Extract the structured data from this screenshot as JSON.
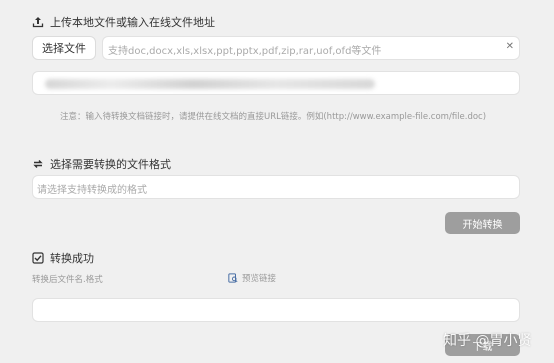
{
  "upload": {
    "title": "上传本地文件或输入在线文件地址",
    "select_button": "选择文件",
    "file_placeholder": "支持doc,docx,xls,xlsx,ppt,pptx,pdf,zip,rar,uof,ofd等文件",
    "clear_glyph": "✕",
    "note": "注意：输入待转换文档链接时，请提供在线文档的直接URL链接。例如(http://www.example-file.com/file.doc)"
  },
  "format": {
    "title": "选择需要转换的文件格式",
    "placeholder": "请选择支持转换成的格式",
    "start_button": "开始转换"
  },
  "result": {
    "title": "转换成功",
    "file_label": "转换后文件名.格式",
    "preview_link": "预览链接",
    "download_button": "下载"
  },
  "watermark": "知乎 @胃小贤",
  "icons": {
    "upload": "upload-icon",
    "convert": "convert-arrows-icon",
    "success": "checkbox-checked-icon",
    "preview": "preview-icon",
    "clear": "close-icon"
  }
}
